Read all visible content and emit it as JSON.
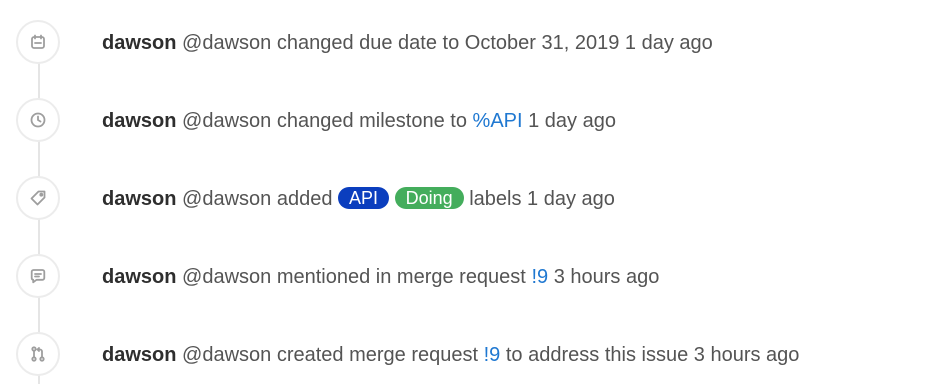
{
  "notes": [
    {
      "icon": "calendar-icon",
      "author": "dawson",
      "username": "@dawson",
      "action": "changed due date to October 31, 2019",
      "time": "1 day ago"
    },
    {
      "icon": "clock-icon",
      "author": "dawson",
      "username": "@dawson",
      "action": "changed milestone to",
      "link": "%API",
      "time": "1 day ago"
    },
    {
      "icon": "tag-icon",
      "author": "dawson",
      "username": "@dawson",
      "action": "added",
      "labels": [
        {
          "text": "API",
          "color": "#0b3ebe"
        },
        {
          "text": "Doing",
          "color": "#44ad5c"
        }
      ],
      "suffix": "labels",
      "time": "1 day ago"
    },
    {
      "icon": "comment-icon",
      "author": "dawson",
      "username": "@dawson",
      "action": "mentioned in merge request",
      "link": "!9",
      "time": "3 hours ago"
    },
    {
      "icon": "merge-request-icon",
      "author": "dawson",
      "username": "@dawson",
      "action": "created merge request",
      "link": "!9",
      "suffix": "to address this issue",
      "time": "3 hours ago"
    }
  ],
  "colors": {
    "link": "#1f78d1",
    "author": "#2e2e2e",
    "text": "#545454",
    "icon": "#9e9e9e",
    "timeline_line": "#e5e5e5"
  }
}
